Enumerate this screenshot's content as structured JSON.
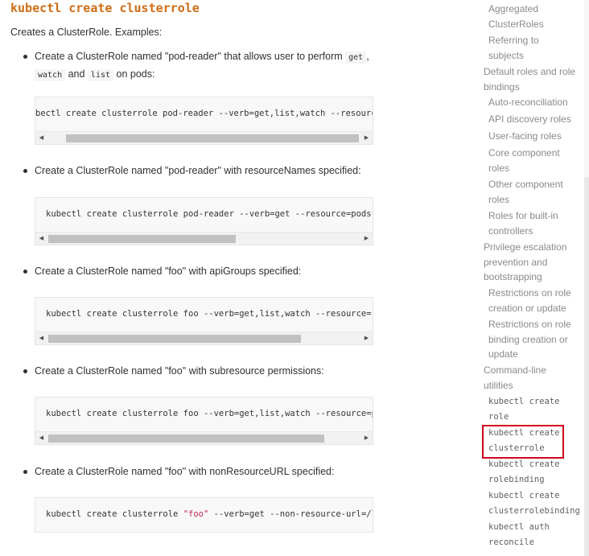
{
  "section": {
    "title": "kubectl create clusterrole",
    "intro": "Creates a ClusterRole. Examples:"
  },
  "examples": [
    {
      "desc_parts": [
        "Create a ClusterRole named \"pod-reader\" that allows user to perform ",
        "get",
        ",",
        "watch",
        " and ",
        "list",
        " on pods:"
      ],
      "code": "bectl create clusterrole pod-reader --verb=get,list,watch --resource=pods"
    },
    {
      "desc": "Create a ClusterRole named \"pod-reader\" with resourceNames specified:",
      "code": "kubectl create clusterrole pod-reader --verb=get --resource=pods --resc"
    },
    {
      "desc": "Create a ClusterRole named \"foo\" with apiGroups specified:",
      "code": "kubectl create clusterrole foo --verb=get,list,watch --resource=replica"
    },
    {
      "desc": "Create a ClusterRole named \"foo\" with subresource permissions:",
      "code": "kubectl create clusterrole foo --verb=get,list,watch --resource=pods,pc"
    },
    {
      "desc": "Create a ClusterRole named \"foo\" with nonResourceURL specified:",
      "code_parts": [
        "kubectl create clusterrole ",
        "\"foo\"",
        " --verb=get --non-resource-url=/logs/*"
      ]
    }
  ],
  "toc": [
    {
      "label": "Aggregated ClusterRoles"
    },
    {
      "label": "Referring to subjects"
    },
    {
      "label": "Default roles and role bindings"
    },
    {
      "label": "Auto-reconciliation"
    },
    {
      "label": "API discovery roles"
    },
    {
      "label": "User-facing roles"
    },
    {
      "label": "Core component roles"
    },
    {
      "label": "Other component roles"
    },
    {
      "label": "Roles for built-in controllers"
    },
    {
      "label": "Privilege escalation prevention and bootstrapping"
    },
    {
      "label": "Restrictions on role creation or update"
    },
    {
      "label": "Restrictions on role binding creation or update"
    },
    {
      "label": "Command-line utilities"
    },
    {
      "label": "kubectl create role"
    },
    {
      "label": "kubectl create clusterrole"
    },
    {
      "label": "kubectl create rolebinding"
    },
    {
      "label": "kubectl create clusterrolebinding"
    },
    {
      "label": "kubectl auth reconcile"
    }
  ],
  "colors": {
    "title": "#d16d15",
    "highlight": "#d0021b",
    "string": "#c7254e"
  }
}
